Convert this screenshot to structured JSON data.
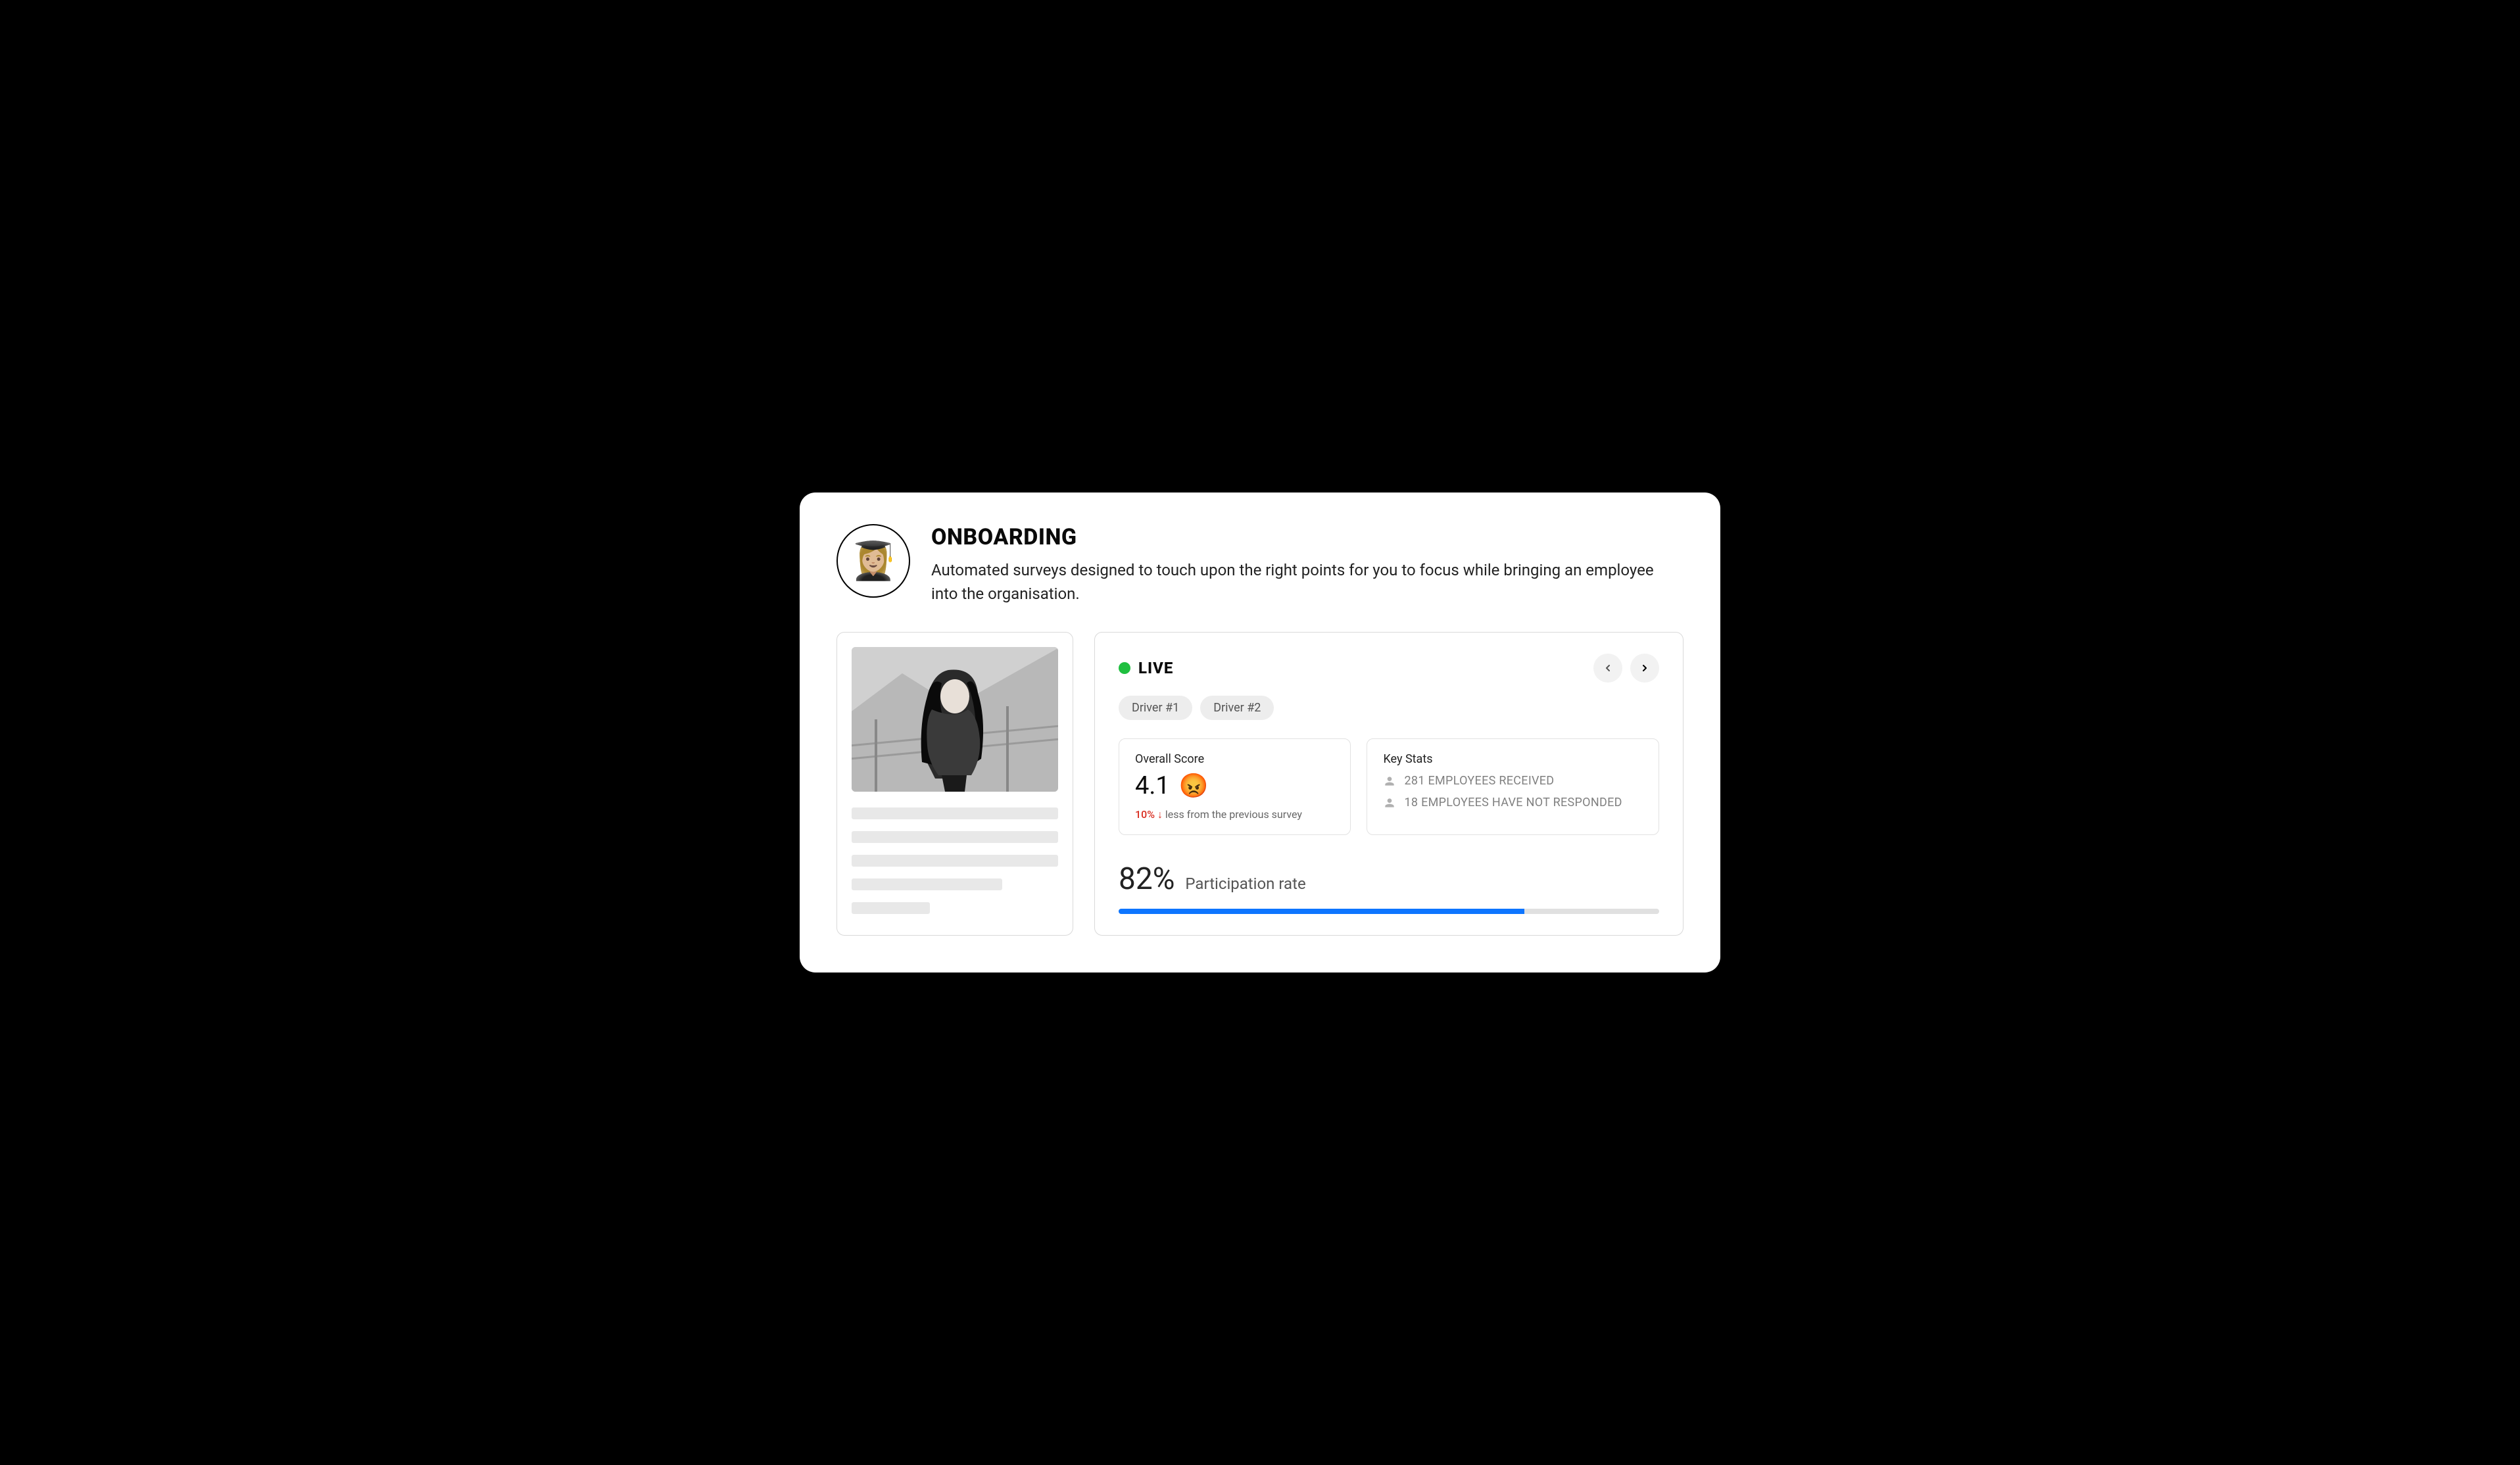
{
  "header": {
    "emoji": "👩🏼‍🎓",
    "title": "ONBOARDING",
    "description": "Automated surveys designed to touch upon the right points for you to focus while bringing an employee into the organisation."
  },
  "status": {
    "label": "LIVE",
    "color": "#1fbf3f"
  },
  "drivers": [
    "Driver #1",
    "Driver #2"
  ],
  "overall": {
    "label": "Overall Score",
    "value": "4.1",
    "emoji": "😡",
    "delta_pct": "10%",
    "delta_text": "less from the previous survey"
  },
  "keystats": {
    "label": "Key Stats",
    "line1": "281 EMPLOYEES RECEIVED",
    "line2": "18 EMPLOYEES HAVE NOT RESPONDED"
  },
  "participation": {
    "pct": "82%",
    "label": "Participation rate",
    "fill_width": "75%"
  }
}
